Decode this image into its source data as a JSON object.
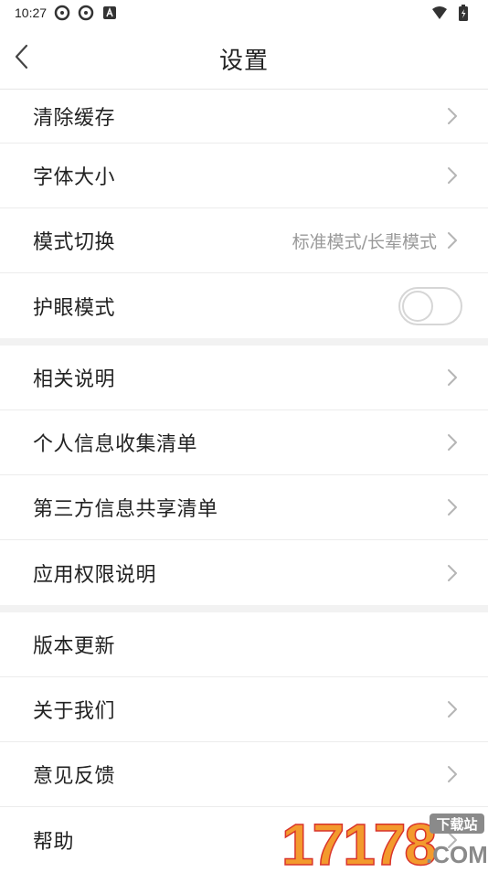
{
  "status_bar": {
    "time": "10:27",
    "icons_left": [
      "sync-icon",
      "sync-icon",
      "a-icon"
    ],
    "icons_right": [
      "wifi-icon",
      "battery-icon"
    ]
  },
  "header": {
    "title": "设置",
    "back_icon": "chevron-left-icon"
  },
  "groups": [
    {
      "items": [
        {
          "label": "清除缓存",
          "has_chevron": true
        },
        {
          "label": "字体大小",
          "has_chevron": true
        },
        {
          "label": "模式切换",
          "value": "标准模式/长辈模式",
          "has_chevron": true
        },
        {
          "label": "护眼模式",
          "toggle": false
        }
      ]
    },
    {
      "items": [
        {
          "label": "相关说明",
          "has_chevron": true
        },
        {
          "label": "个人信息收集清单",
          "has_chevron": true
        },
        {
          "label": "第三方信息共享清单",
          "has_chevron": true
        },
        {
          "label": "应用权限说明",
          "has_chevron": true
        }
      ]
    },
    {
      "items": [
        {
          "label": "版本更新",
          "has_chevron": false
        },
        {
          "label": "关于我们",
          "has_chevron": true
        },
        {
          "label": "意见反馈",
          "has_chevron": true
        },
        {
          "label": "帮助",
          "has_chevron": true
        }
      ]
    }
  ],
  "watermark": {
    "digits": "17178",
    "badge": "下载站",
    "suffix": ".COM",
    "colors": {
      "orange": "#f39a2d",
      "red": "#d9342b",
      "gray": "#8a8a8a"
    }
  },
  "colors": {
    "text": "#222222",
    "secondary": "#999999",
    "divider": "#ececec",
    "gap": "#f2f2f2"
  }
}
